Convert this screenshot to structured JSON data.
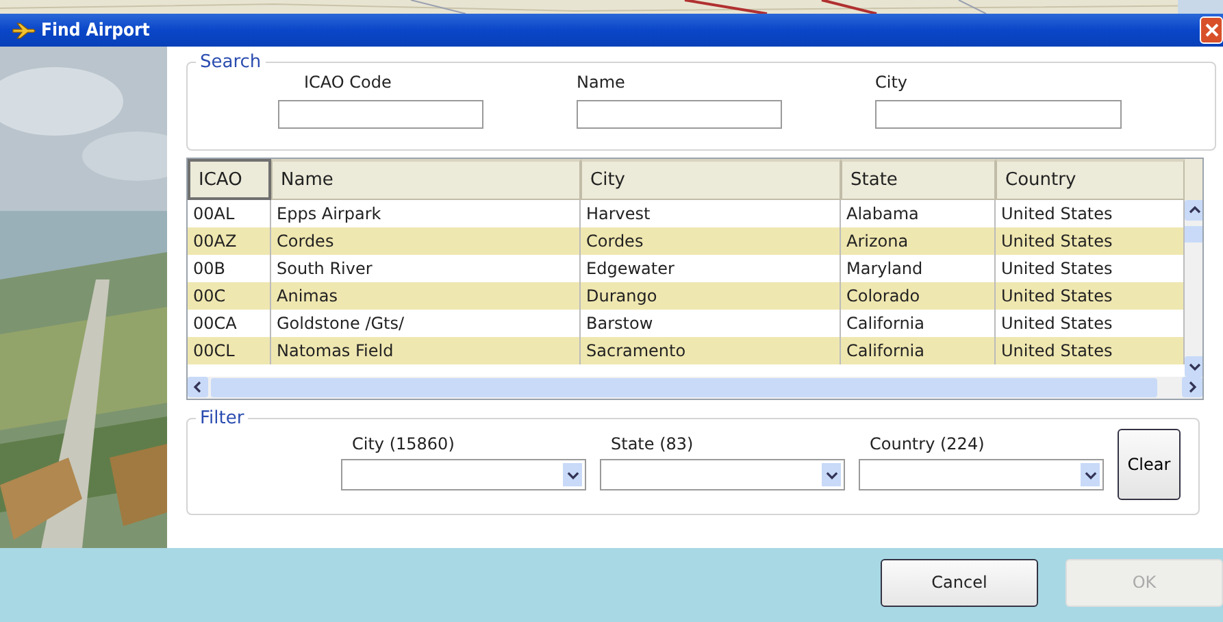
{
  "window": {
    "title": "Find Airport"
  },
  "search": {
    "label": "Search",
    "fields": [
      {
        "label": "ICAO Code"
      },
      {
        "label": "Name"
      },
      {
        "label": "City"
      }
    ]
  },
  "table": {
    "columns": [
      "ICAO",
      "Name",
      "City",
      "State",
      "Country"
    ],
    "rows": [
      [
        "00AL",
        "Epps Airpark",
        "Harvest",
        "Alabama",
        "United States"
      ],
      [
        "00AZ",
        "Cordes",
        "Cordes",
        "Arizona",
        "United States"
      ],
      [
        "00B",
        "South River",
        "Edgewater",
        "Maryland",
        "United States"
      ],
      [
        "00C",
        "Animas",
        "Durango",
        "Colorado",
        "United States"
      ],
      [
        "00CA",
        "Goldstone /Gts/",
        "Barstow",
        "California",
        "United States"
      ],
      [
        "00CL",
        "Natomas Field",
        "Sacramento",
        "California",
        "United States"
      ]
    ]
  },
  "filter": {
    "label": "Filter",
    "dropdowns": [
      {
        "label": "City (15860)"
      },
      {
        "label": "State (83)"
      },
      {
        "label": "Country (224)"
      }
    ],
    "clear_button": "Clear"
  },
  "buttons": [
    {
      "label": "Cancel",
      "disabled": false
    },
    {
      "label": "OK",
      "disabled": true
    }
  ]
}
